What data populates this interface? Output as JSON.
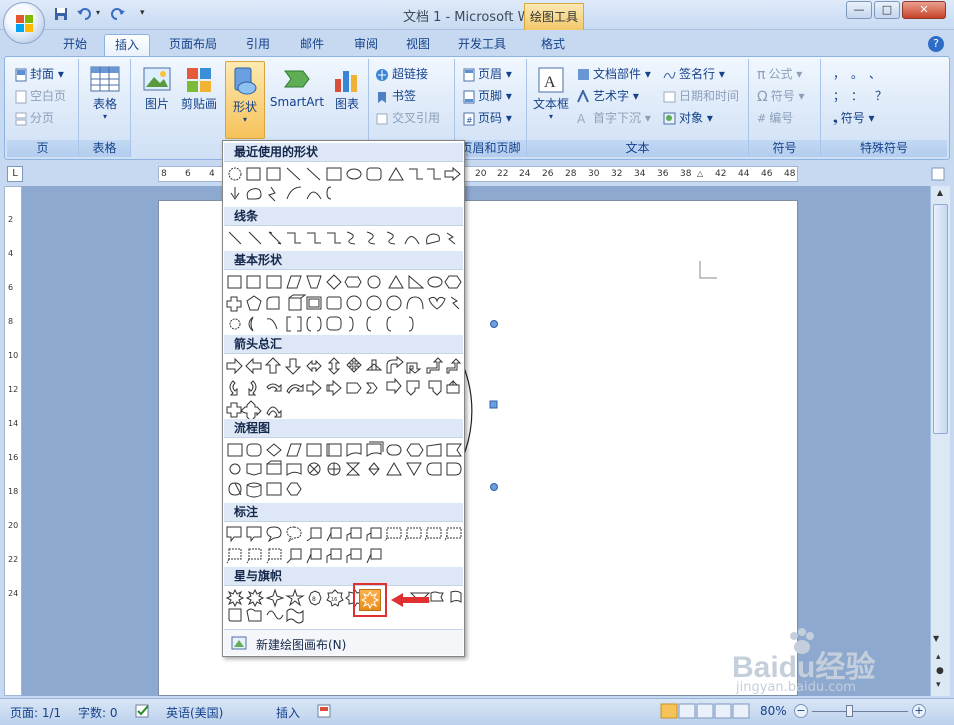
{
  "window": {
    "title": "文档 1 - Microsoft Word",
    "context_tab": "绘图工具",
    "min": "—",
    "max": "□",
    "close": "✕"
  },
  "tabs": [
    "开始",
    "插入",
    "页面布局",
    "引用",
    "邮件",
    "审阅",
    "视图",
    "开发工具",
    "格式"
  ],
  "active_tab": "插入",
  "ribbon": {
    "pages_group": {
      "label": "页",
      "items": [
        "封面",
        "空白页",
        "分页"
      ]
    },
    "table_group": {
      "label": "表格",
      "button": "表格"
    },
    "illustrations_group": {
      "buttons": [
        "图片",
        "剪贴画",
        "形状",
        "SmartArt",
        "图表"
      ]
    },
    "links_group": {
      "items": [
        "超链接",
        "书签",
        "交叉引用"
      ]
    },
    "header_footer_group": {
      "label": "页眉和页脚",
      "items": [
        "页眉",
        "页脚",
        "页码"
      ]
    },
    "text_group": {
      "label": "文本",
      "textbox": "文本框",
      "items": [
        "文档部件",
        "艺术字",
        "首字下沉",
        "签名行",
        "日期和时间",
        "对象"
      ]
    },
    "symbols_group": {
      "label": "符号",
      "items": [
        "公式",
        "符号",
        "编号"
      ]
    },
    "special_group": {
      "label": "特殊符号",
      "item": "符号",
      "chars": [
        "，",
        "。",
        "、",
        "；",
        "：",
        "？"
      ]
    }
  },
  "ruler": {
    "left_numbers": [
      "8",
      "6",
      "4"
    ],
    "right_numbers": [
      "20",
      "22",
      "24",
      "26",
      "28",
      "30",
      "32",
      "34",
      "36",
      "38",
      "42",
      "44",
      "46",
      "48"
    ],
    "vertical_numbers": [
      "2",
      "4",
      "6",
      "8",
      "10",
      "12",
      "14",
      "16",
      "18",
      "20",
      "22",
      "24"
    ]
  },
  "shapes_menu": {
    "categories": [
      "最近使用的形状",
      "线条",
      "基本形状",
      "箭头总汇",
      "流程图",
      "标注",
      "星与旗帜"
    ],
    "footer": "新建绘图画布(N)"
  },
  "status": {
    "page": "页面: 1/1",
    "words": "字数: 0",
    "language": "英语(美国)",
    "mode": "插入",
    "zoom": "80%"
  },
  "watermark": {
    "brand": "Baidu经验",
    "url": "jingyan.baidu.com"
  },
  "colors": {
    "ribbon_bg": "#dbe8f8",
    "highlight": "#f2b144",
    "red_annotation": "#e03030"
  }
}
